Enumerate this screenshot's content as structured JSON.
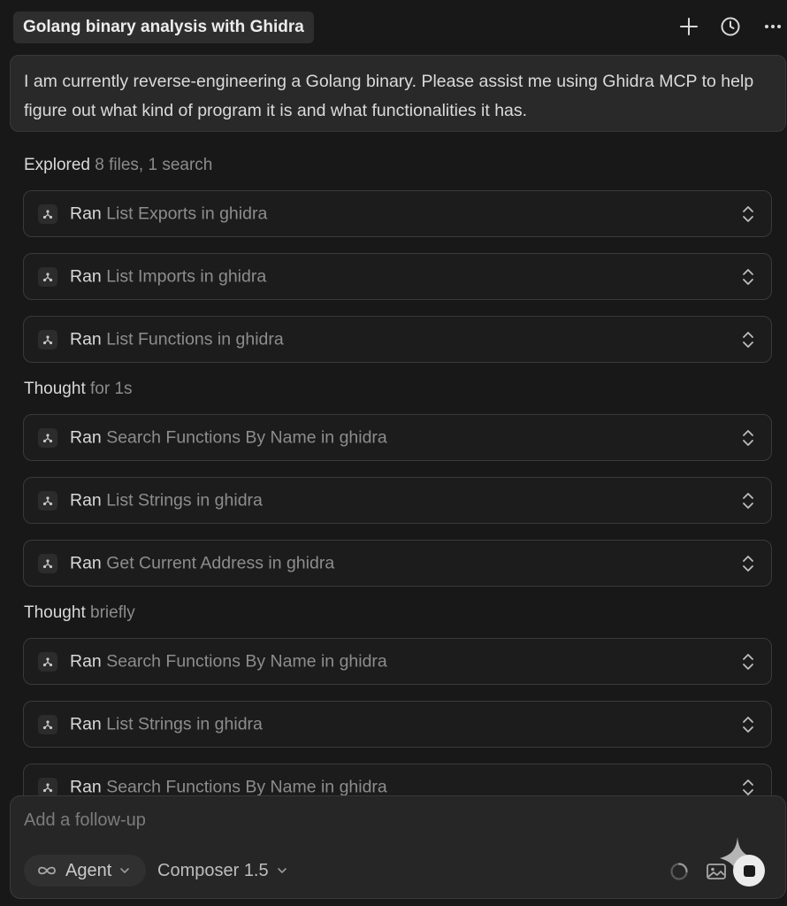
{
  "header": {
    "title": "Golang binary analysis with Ghidra",
    "icons": [
      "plus-icon",
      "history-clock-icon",
      "more-icon"
    ]
  },
  "user_message": {
    "text": "I am currently reverse-engineering a Golang binary. Please assist me using Ghidra MCP to help figure out what kind of program it is and what functionalities it has."
  },
  "sections": [
    {
      "label": "Explored",
      "detail": "8 files, 1 search"
    },
    {
      "label": "Thought",
      "detail": "for 1s"
    },
    {
      "label": "Thought",
      "detail": "briefly"
    }
  ],
  "tool_calls": [
    {
      "verb": "Ran",
      "desc": "List Exports in ghidra"
    },
    {
      "verb": "Ran",
      "desc": "List Imports in ghidra"
    },
    {
      "verb": "Ran",
      "desc": "List Functions in ghidra"
    },
    {
      "verb": "Ran",
      "desc": "Search Functions By Name in ghidra"
    },
    {
      "verb": "Ran",
      "desc": "List Strings in ghidra"
    },
    {
      "verb": "Ran",
      "desc": "Get Current Address in ghidra"
    },
    {
      "verb": "Ran",
      "desc": "Search Functions By Name in ghidra"
    },
    {
      "verb": "Ran",
      "desc": "List Strings in ghidra"
    },
    {
      "verb": "Ran",
      "desc": "Search Functions By Name in ghidra"
    }
  ],
  "composer": {
    "placeholder": "Add a follow-up",
    "mode": "Agent",
    "model": "Composer 1.5",
    "icons": [
      "infinity-icon",
      "loading-spinner-icon",
      "image-icon",
      "stop-icon"
    ]
  },
  "colors": {
    "background": "#181818",
    "panel": "#292929",
    "border": "#3a3a3a",
    "text": "#d9d9d9",
    "muted": "#8b8b8b"
  }
}
